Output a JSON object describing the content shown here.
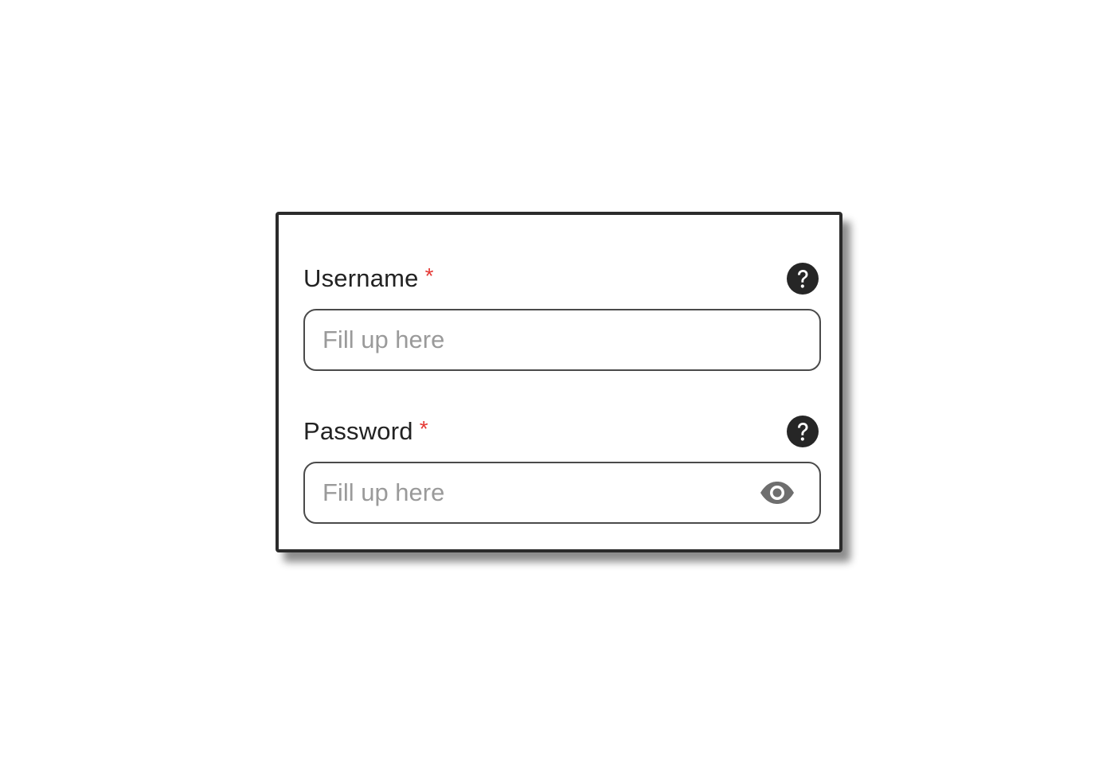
{
  "form": {
    "username": {
      "label": "Username",
      "required_marker": "*",
      "placeholder": "Fill up here",
      "value": "",
      "help_icon": "question-circle-icon"
    },
    "password": {
      "label": "Password",
      "required_marker": "*",
      "placeholder": "Fill up here",
      "value": "",
      "help_icon": "question-circle-icon",
      "visibility_icon": "eye-icon"
    }
  },
  "colors": {
    "border": "#2b2b2b",
    "required": "#e53935",
    "placeholder": "#9a9a9a",
    "icon": "#262626",
    "eye_icon": "#6e6e6e"
  }
}
